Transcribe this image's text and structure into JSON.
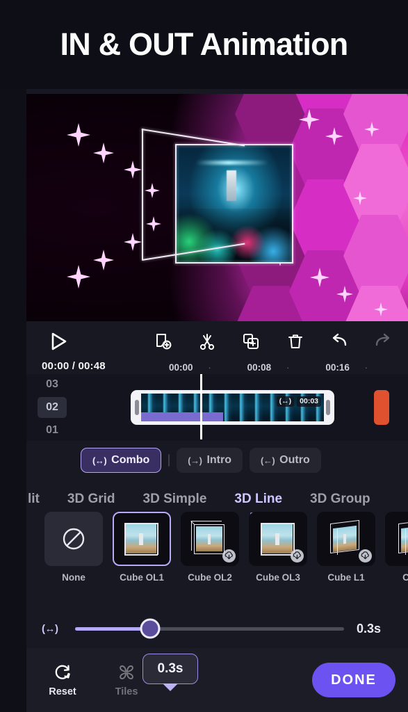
{
  "header": {
    "title": "IN & OUT Animation"
  },
  "preview": {
    "name": "video-preview",
    "description": "3D cube animation over magenta hexagon background with glowing stars"
  },
  "toolbar": {
    "play": "play-icon",
    "items": [
      {
        "name": "add-clip-icon",
        "label": "Add clip"
      },
      {
        "name": "split-scissors-icon",
        "label": "Split"
      },
      {
        "name": "duplicate-icon",
        "label": "Duplicate"
      },
      {
        "name": "delete-trash-icon",
        "label": "Delete"
      },
      {
        "name": "undo-icon",
        "label": "Undo"
      },
      {
        "name": "redo-icon",
        "label": "Redo"
      }
    ]
  },
  "timeline": {
    "current_time": "00:00",
    "total_time": "00:48",
    "time_display": "00:00 / 00:48",
    "ruler": [
      "00:00",
      "·",
      "00:08",
      "·",
      "00:16",
      "·"
    ],
    "tracks": [
      {
        "label": "03",
        "active": false
      },
      {
        "label": "02",
        "active": true
      },
      {
        "label": "01",
        "active": false
      }
    ],
    "clip": {
      "combo_badge": "(↔)",
      "duration_badge": "00:03"
    }
  },
  "mode_tabs": [
    {
      "icon": "(↔)",
      "label": "Combo",
      "active": true
    },
    {
      "icon": "(→)",
      "label": "Intro",
      "active": false
    },
    {
      "icon": "(←)",
      "label": "Outro",
      "active": false
    }
  ],
  "category_tabs": [
    {
      "label": "lit",
      "active": false
    },
    {
      "label": "3D Grid",
      "active": false
    },
    {
      "label": "3D Simple",
      "active": false
    },
    {
      "label": "3D Line",
      "active": true
    },
    {
      "label": "3D Group",
      "active": false
    }
  ],
  "presets": [
    {
      "label": "None",
      "type": "none",
      "selected": false,
      "download": false
    },
    {
      "label": "Cube OL1",
      "type": "cube-front",
      "selected": true,
      "download": false
    },
    {
      "label": "Cube OL2",
      "type": "cube-box",
      "selected": false,
      "download": true
    },
    {
      "label": "Cube OL3",
      "type": "cube-front",
      "selected": false,
      "download": true
    },
    {
      "label": "Cube L1",
      "type": "cube-angle",
      "selected": false,
      "download": true
    },
    {
      "label": "Cube",
      "type": "cube-angle",
      "selected": false,
      "download": false
    }
  ],
  "tooltip": {
    "value": "0.3s"
  },
  "slider": {
    "icon": "(↔)",
    "value": "0.3s",
    "fill_percent": 28
  },
  "bottom_bar": {
    "reset_label": "Reset",
    "tiles_label": "Tiles",
    "done_label": "DONE"
  },
  "colors": {
    "accent": "#6c52f0",
    "accent_light": "#b4a9f7",
    "panel": "#171822",
    "page_bg": "#0e0f17",
    "orange_clip": "#e0512f"
  }
}
